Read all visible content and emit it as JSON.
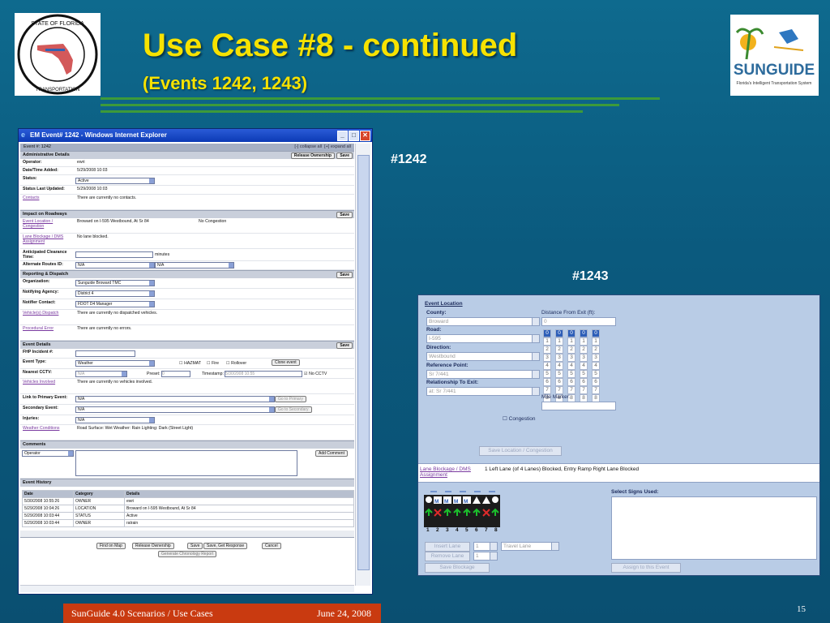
{
  "slide": {
    "title": "Use Case #8 - continued",
    "subtitle": "(Events 1242, 1243)",
    "label_1242": "#1242",
    "label_1243": "#1243",
    "footer_left": "SunGuide 4.0 Scenarios / Use Cases",
    "footer_right": "June 24, 2008",
    "page_number": "15",
    "logo_left_text": "STATE OF FLORIDA DEPARTMENT OF TRANSPORTATION",
    "logo_right_text": "SUNGUIDE",
    "logo_right_sub": "Florida's Intelligent Transportation System"
  },
  "ie_window": {
    "title": "EM Event# 1242 - Windows Internet Explorer",
    "event_label": "Event #: 1242",
    "collapse": "[-] collapse all",
    "expand": "[+] expand all",
    "admin": {
      "header": "Administrative Details",
      "release_btn": "Release Ownership",
      "save_btn": "Save",
      "operator_k": "Operator:",
      "operator_v": "ewri",
      "added_k": "Date/Time Added:",
      "added_v": "5/29/2008 10:03",
      "status_k": "Status:",
      "status_v": "Active",
      "updated_k": "Status Last Updated:",
      "updated_v": "5/29/2008 10:03",
      "contacts_k": "Contacts",
      "contacts_v": "There are currently no contacts."
    },
    "impact": {
      "header": "Impact on Roadways",
      "save_btn": "Save",
      "loc_k": "Event Location / Congestion",
      "loc_v": "Broward on I-595 Westbound, At Sr 84",
      "loc_v2": "No Congestion",
      "lane_k": "Lane Blockage / DMS Assignment",
      "lane_v": "No lane blocked.",
      "clear_k": "Anticipated Clearance Time:",
      "clear_unit": "minutes",
      "alt_k": "Alternate Routes ID:",
      "alt_v1": "N/A",
      "alt_v2": "N/A"
    },
    "reporting": {
      "header": "Reporting & Dispatch",
      "save_btn": "Save",
      "org_k": "Organization:",
      "org_v": "Sunguide Broward TMC",
      "agency_k": "Notifying Agency:",
      "agency_v": "District 4",
      "contact_k": "Notifier Contact:",
      "contact_v": "FDOT D4 Manager",
      "vehicles_k": "Vehicle(s) Dispatch",
      "vehicles_v": "There are currently no dispatched vehicles.",
      "proc_k": "Procedural Error",
      "proc_v": "There are currently no errors."
    },
    "details": {
      "header": "Event Details",
      "save_btn": "Save",
      "fhp_k": "FHP Incident #:",
      "type_k": "Event Type:",
      "type_v": "Weather",
      "hazmat": "HAZMAT",
      "fire": "Fire",
      "rollover": "Rollover",
      "clone_btn": "Clone event",
      "cctv_k": "Nearest CCTV:",
      "cctv_v": "N/A",
      "preset": "Preset:",
      "preset_v": "0",
      "timestamp": "Timestamp:",
      "timestamp_v": "5/30/2008 10:55",
      "no_cctv": "No CCTV",
      "veh_k": "Vehicles Involved",
      "veh_v": "There are currently no vehicles involved.",
      "link_k": "Link to Primary Event:",
      "link_v": "N/A",
      "link_btn": "Go to Primary",
      "sec_k": "Secondary Event:",
      "sec_v": "N/A",
      "sec_btn": "Go to Secondary",
      "inj_k": "Injuries:",
      "inj_v": "N/A",
      "wx_k": "Weather Conditions",
      "wx_v": "Road Surface: Wet  Weather: Rain  Lighting: Dark (Street Light)"
    },
    "comments": {
      "header": "Comments",
      "who": "Operator",
      "add_btn": "Add Comment"
    },
    "history": {
      "header": "Event History",
      "columns": [
        "Date",
        "Category",
        "Details"
      ],
      "rows": [
        [
          "5/30/2008 10:55:26",
          "OWNER",
          "ewri"
        ],
        [
          "5/29/2008 10:04:26",
          "LOCATION",
          "Broward on I-595 Westbound, At Sr 84"
        ],
        [
          "5/29/2008 10:03:44",
          "STATUS",
          "Active"
        ],
        [
          "5/29/2008 10:03:44",
          "OWNER",
          "ratrain"
        ]
      ]
    },
    "bottom_buttons": [
      "Find on Map",
      "Release Ownership",
      "Save",
      "Save, Get Response",
      "Cancel"
    ],
    "chron_btn": "Generate Chronology Report"
  },
  "panel_1243": {
    "header": "Event Location",
    "county_k": "County:",
    "county_v": "Broward",
    "road_k": "Road:",
    "road_v": "I-595",
    "dir_k": "Direction:",
    "dir_v": "Westbound",
    "ref_k": "Reference Point:",
    "ref_v": "Sr 7/441",
    "rel_k": "Relationship To Exit:",
    "rel_v": "at: Sr 7/441",
    "dist_k": "Distance From Exit (ft):",
    "dist_v": "0",
    "mile_k": "Mile Marker:",
    "digits": [
      "0",
      "1",
      "2",
      "3",
      "4",
      "5",
      "6",
      "7",
      "8",
      "9"
    ],
    "congestion": "Congestion",
    "save_loc_btn": "Save Location / Congestion",
    "lane_link": "Lane Blockage / DMS Assignment",
    "lane_text": "1 Left Lane (of 4 Lanes) Blocked, Entry Ramp Right Lane Blocked",
    "signs_label": "Select Signs Used:",
    "lane_numbers": [
      "1",
      "2",
      "3",
      "4",
      "5",
      "6",
      "7",
      "8"
    ],
    "insert_lane": "Insert Lane",
    "insert_qty": "1",
    "lane_type": "Travel Lane",
    "remove_lane": "Remove Lane",
    "remove_qty": "1",
    "save_blockage": "Save Blockage",
    "assign_btn": "Assign to this Event"
  }
}
